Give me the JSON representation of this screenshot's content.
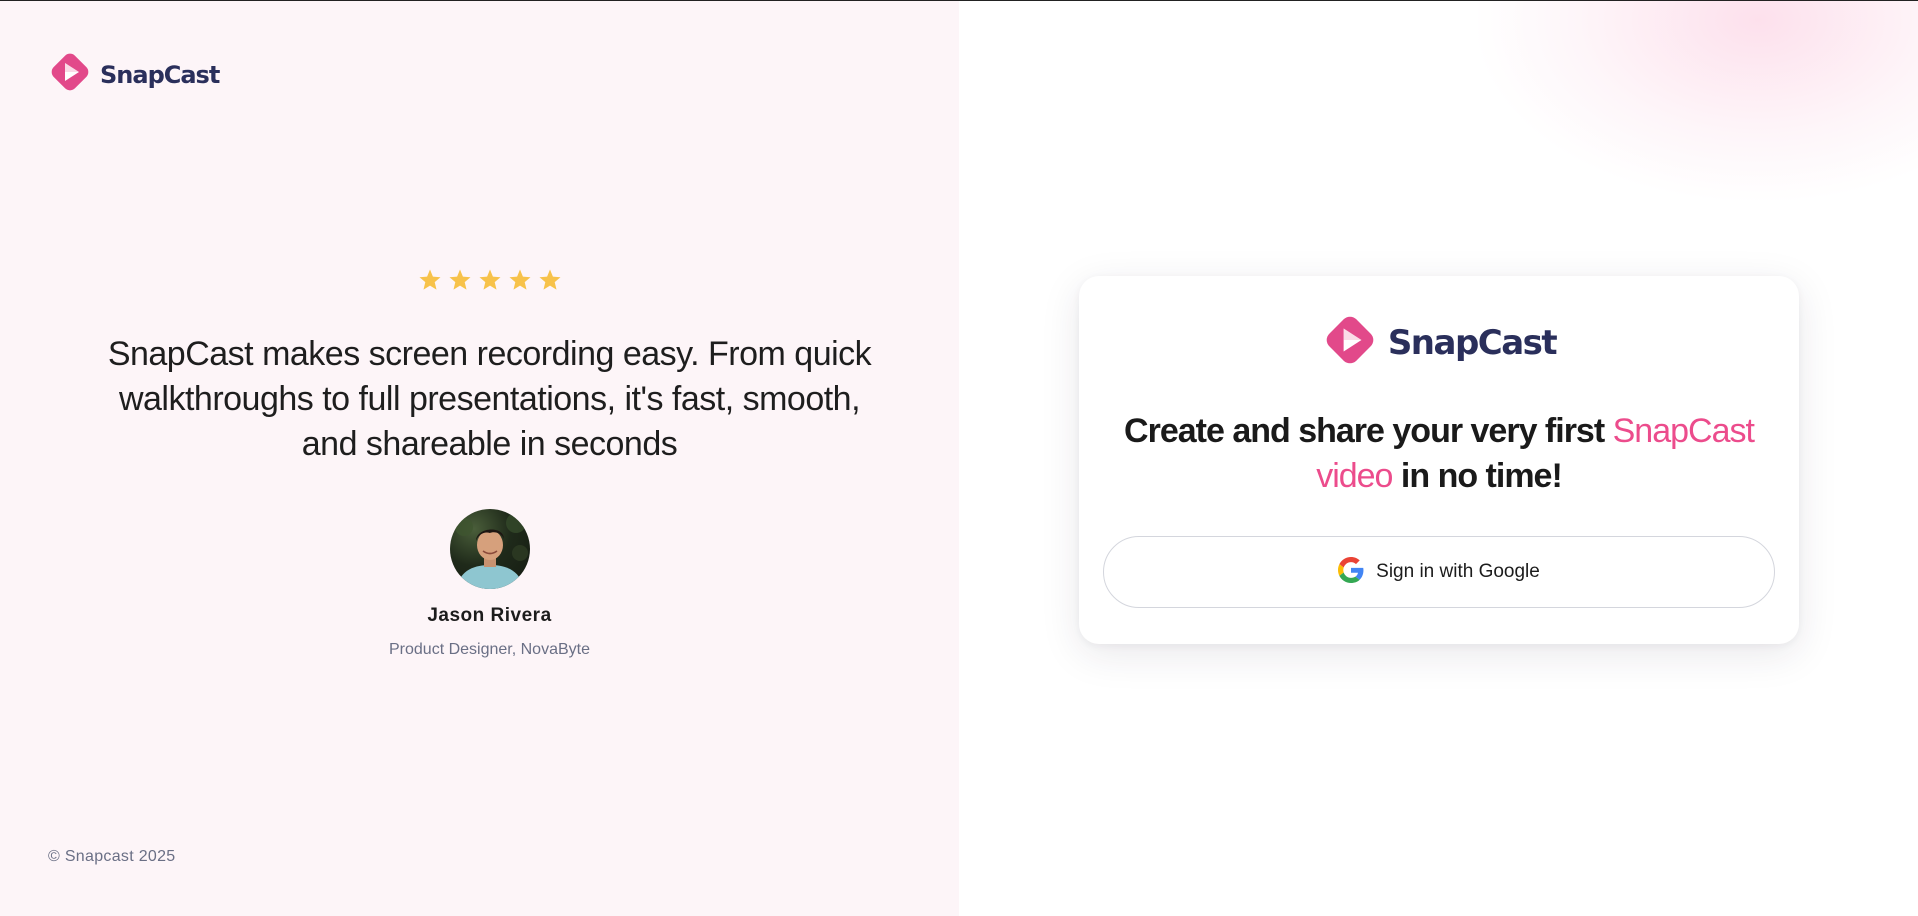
{
  "brand": {
    "name": "SnapCast",
    "colors": {
      "primary": "#e2498a",
      "dark": "#2a2f5b",
      "accent": "#ec4c8c"
    }
  },
  "testimonial": {
    "rating": 5,
    "star_color": "#f7c24a",
    "quote": "SnapCast makes screen recording easy. From quick walkthroughs to full presentations, it's fast, smooth, and shareable in seconds",
    "author": "Jason Rivera",
    "role": "Product Designer, NovaByte"
  },
  "footer": {
    "copyright": "© Snapcast 2025"
  },
  "card": {
    "brand_name": "SnapCast",
    "headline_part1": "Create and share your very first ",
    "headline_accent": "SnapCast video",
    "headline_part2": " in no time!",
    "google_button_label": "Sign in with Google"
  }
}
